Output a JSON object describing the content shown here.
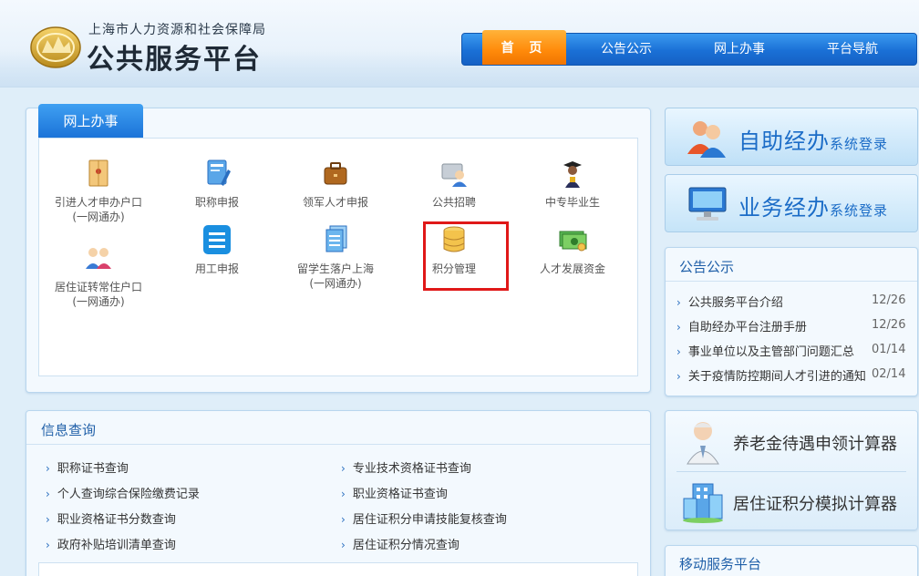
{
  "header": {
    "org_name": "上海市人力资源和社会保障局",
    "title": "公共服务平台",
    "emblem_icon": "gold-seal-icon"
  },
  "nav": {
    "items": [
      {
        "label": "首 页",
        "active": true
      },
      {
        "label": "公告公示",
        "active": false
      },
      {
        "label": "网上办事",
        "active": false
      },
      {
        "label": "平台导航",
        "active": false
      }
    ]
  },
  "online": {
    "tab": "网上办事",
    "services": [
      {
        "icon": "envelope-icon",
        "line1": "引进人才申办户口",
        "line2": "(一网通办)"
      },
      {
        "icon": "certificate-edit-icon",
        "line1": "职称申报",
        "line2": ""
      },
      {
        "icon": "briefcase-icon",
        "line1": "领军人才申报",
        "line2": ""
      },
      {
        "icon": "recruit-icon",
        "line1": "公共招聘",
        "line2": ""
      },
      {
        "icon": "graduate-icon",
        "line1": "中专毕业生",
        "line2": ""
      },
      {
        "icon": "couple-icon",
        "line1": "居住证转常住户口",
        "line2": "(一网通办)"
      },
      {
        "icon": "list-document-icon",
        "line1": "用工申报",
        "line2": ""
      },
      {
        "icon": "documents-stack-icon",
        "line1": "留学生落户上海",
        "line2": "(一网通办)"
      },
      {
        "icon": "database-icon",
        "line1": "积分管理",
        "line2": ""
      },
      {
        "icon": "money-icon",
        "line1": "人才发展资金",
        "line2": ""
      }
    ]
  },
  "query": {
    "title": "信息查询",
    "left": [
      "职称证书查询",
      "个人查询综合保险缴费记录",
      "职业资格证书分数查询",
      "政府补贴培训清单查询"
    ],
    "right": [
      "专业技术资格证书查询",
      "职业资格证书查询",
      "居住证积分申请技能复核查询",
      "居住证积分情况查询"
    ]
  },
  "login_banners": [
    {
      "big": "自助经办",
      "small": "系统登录",
      "icon": "users-icon"
    },
    {
      "big": "业务经办",
      "small": "系统登录",
      "icon": "monitor-icon"
    }
  ],
  "notice": {
    "title": "公告公示",
    "items": [
      {
        "text": "公共服务平台介绍",
        "date": "12/26"
      },
      {
        "text": "自助经办平台注册手册",
        "date": "12/26"
      },
      {
        "text": "事业单位以及主管部门问题汇总",
        "date": "01/14"
      },
      {
        "text": "关于疫情防控期间人才引进的通知",
        "date": "02/14"
      }
    ]
  },
  "calculators": [
    {
      "label": "养老金待遇申领计算器",
      "icon": "elderly-man-icon"
    },
    {
      "label": "居住证积分模拟计算器",
      "icon": "building-icon"
    }
  ],
  "mobile": {
    "title": "移动服务平台"
  },
  "colors": {
    "nav_blue": "#1a70d6",
    "nav_active": "#ff8a0a",
    "link_blue": "#1f5fa8",
    "highlight": "#e01818"
  }
}
